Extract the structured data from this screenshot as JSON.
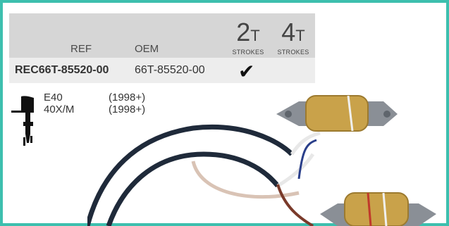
{
  "table": {
    "headers": {
      "ref": "REF",
      "oem": "OEM"
    },
    "strokes": [
      {
        "number": "2",
        "unit": "T",
        "label": "STROKES"
      },
      {
        "number": "4",
        "unit": "T",
        "label": "STROKES"
      }
    ],
    "row": {
      "ref": "REC66T-85520-00",
      "oem": "66T-85520-00",
      "check_2t": "✔"
    }
  },
  "applications": [
    {
      "model": "E40",
      "year": "(1998+)"
    },
    {
      "model": "40X/M",
      "year": "(1998+)"
    }
  ],
  "colors": {
    "border": "#3dbfae",
    "header": "#d6d6d6",
    "row": "#ededed"
  },
  "icons": [
    "outboard-engine-icon",
    "check-icon"
  ]
}
